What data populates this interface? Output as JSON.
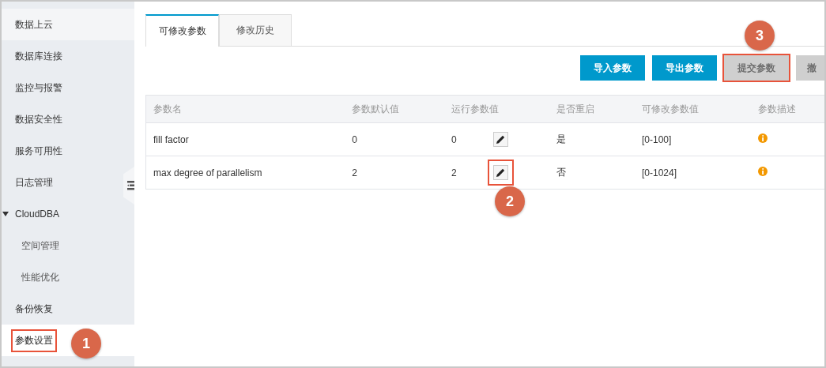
{
  "sidebar": {
    "items": [
      {
        "label": "数据上云",
        "selected": false,
        "highlighted": false
      },
      {
        "label": "数据库连接",
        "selected": false,
        "highlighted": false
      },
      {
        "label": "监控与报警",
        "selected": false,
        "highlighted": false
      },
      {
        "label": "数据安全性",
        "selected": false,
        "highlighted": false
      },
      {
        "label": "服务可用性",
        "selected": false,
        "highlighted": false
      },
      {
        "label": "日志管理",
        "selected": false,
        "highlighted": false
      },
      {
        "label": "CloudDBA",
        "selected": false,
        "highlighted": false,
        "expanded": true,
        "children": [
          {
            "label": "空间管理",
            "selected": false,
            "highlighted": false
          },
          {
            "label": "性能优化",
            "selected": false,
            "highlighted": false
          }
        ]
      },
      {
        "label": "备份恢复",
        "selected": false,
        "highlighted": false
      },
      {
        "label": "参数设置",
        "selected": true,
        "highlighted": true
      }
    ]
  },
  "tabs": [
    {
      "label": "可修改参数",
      "selected": true
    },
    {
      "label": "修改历史",
      "selected": false
    }
  ],
  "toolbar": {
    "buttons": [
      {
        "label": "导入参数",
        "disabled": false,
        "highlighted": false
      },
      {
        "label": "导出参数",
        "disabled": false,
        "highlighted": false
      },
      {
        "label": "提交参数",
        "disabled": true,
        "highlighted": true
      },
      {
        "label": "撤",
        "disabled": true,
        "highlighted": false
      }
    ]
  },
  "table": {
    "columns": [
      "参数名",
      "参数默认值",
      "运行参数值",
      "是否重启",
      "可修改参数值",
      "参数描述"
    ],
    "rows": [
      {
        "name": "fill factor",
        "default": "0",
        "running": "0",
        "restart": "是",
        "range": "[0-100]",
        "edit_highlighted": false
      },
      {
        "name": "max degree of parallelism",
        "default": "2",
        "running": "2",
        "restart": "否",
        "range": "[0-1024]",
        "edit_highlighted": true
      }
    ]
  },
  "callouts": [
    {
      "number": "1"
    },
    {
      "number": "2"
    },
    {
      "number": "3"
    }
  ]
}
